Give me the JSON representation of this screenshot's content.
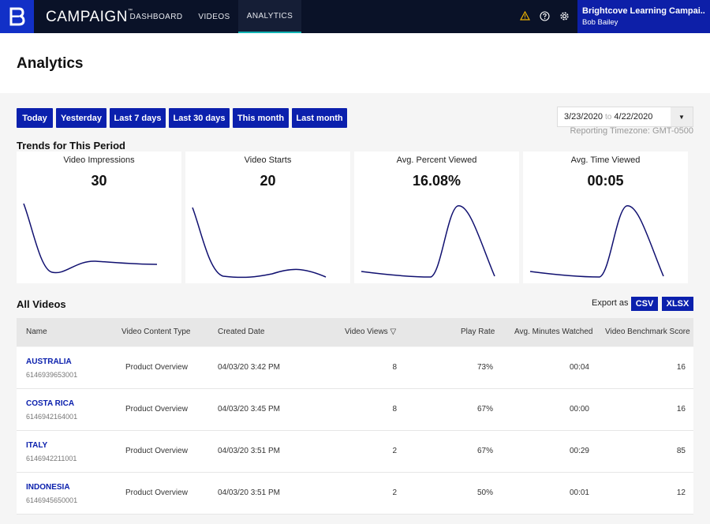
{
  "app": {
    "brand": "CAMPAIGN",
    "brand_mark": "™",
    "logo_letter": "B"
  },
  "nav": {
    "items": [
      {
        "label": "DASHBOARD"
      },
      {
        "label": "VIDEOS"
      },
      {
        "label": "ANALYTICS",
        "active": true
      }
    ]
  },
  "account": {
    "name": "Brightcove Learning Campai...",
    "user": "Bob Bailey"
  },
  "page": {
    "title": "Analytics"
  },
  "ranges": [
    "Today",
    "Yesterday",
    "Last 7 days",
    "Last 30 days",
    "This month",
    "Last month"
  ],
  "date_range": {
    "start": "3/23/2020",
    "to": "to",
    "end": "4/22/2020",
    "timezone": "Reporting Timezone: GMT-0500"
  },
  "trends": {
    "title": "Trends for This Period",
    "cards": [
      {
        "label": "Video Impressions",
        "value": "30"
      },
      {
        "label": "Video Starts",
        "value": "20"
      },
      {
        "label": "Avg. Percent Viewed",
        "value": "16.08%"
      },
      {
        "label": "Avg. Time Viewed",
        "value": "00:05"
      }
    ]
  },
  "videos": {
    "title": "All Videos",
    "export_label": "Export as",
    "export_csv": "CSV",
    "export_xlsx": "XLSX",
    "columns": [
      "Name",
      "Video Content Type",
      "Created Date",
      "Video Views",
      "Play Rate",
      "Avg. Minutes Watched",
      "Video Benchmark Score"
    ],
    "sort_icon": "▽",
    "rows": [
      {
        "name": "AUSTRALIA",
        "id": "6146939653001",
        "type": "Product Overview",
        "created": "04/03/20 3:42 PM",
        "views": "8",
        "play_rate": "73%",
        "avg_minutes": "00:04",
        "score": "16"
      },
      {
        "name": "COSTA RICA",
        "id": "6146942164001",
        "type": "Product Overview",
        "created": "04/03/20 3:45 PM",
        "views": "8",
        "play_rate": "67%",
        "avg_minutes": "00:00",
        "score": "16"
      },
      {
        "name": "ITALY",
        "id": "6146942211001",
        "type": "Product Overview",
        "created": "04/03/20 3:51 PM",
        "views": "2",
        "play_rate": "67%",
        "avg_minutes": "00:29",
        "score": "85"
      },
      {
        "name": "INDONESIA",
        "id": "6146945650001",
        "type": "Product Overview",
        "created": "04/03/20 3:51 PM",
        "views": "2",
        "play_rate": "50%",
        "avg_minutes": "00:01",
        "score": "12"
      }
    ]
  },
  "colors": {
    "accent": "#0b20ad",
    "topbar": "#0a1228",
    "active_underline": "#12b4b4",
    "warning": "#f0b400",
    "sparkline": "#101070"
  }
}
